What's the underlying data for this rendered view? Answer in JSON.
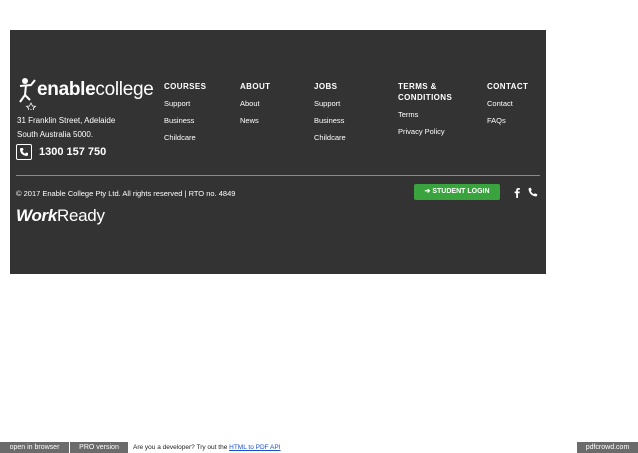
{
  "footer": {
    "logo": {
      "bold": "enable",
      "thin": "college"
    },
    "address_line1": "31 Franklin Street, Adelaide",
    "address_line2": "South Australia 5000.",
    "phone": "1300 157 750",
    "columns": [
      {
        "title": "COURSES",
        "links": [
          "Support",
          "Business",
          "Childcare"
        ]
      },
      {
        "title": "ABOUT",
        "links": [
          "About",
          "News"
        ]
      },
      {
        "title": "JOBS",
        "links": [
          "Support",
          "Business",
          "Childcare"
        ]
      },
      {
        "title": "TERMS & CONDITIONS",
        "links": [
          "Terms",
          "Privacy Policy"
        ]
      },
      {
        "title": "CONTACT",
        "links": [
          "Contact",
          "FAQs"
        ]
      }
    ],
    "copyright": "© 2017 Enable College Pty Ltd. All rights reserved | RTO no. 4849",
    "login_label": "STUDENT LOGIN",
    "workready": {
      "bold": "Work",
      "thin": "Ready"
    }
  },
  "pdf_bar": {
    "open_browser": "open in browser",
    "pro_version": "PRO version",
    "dev_prefix": "Are you a developer? Try out the ",
    "dev_link": "HTML to PDF API",
    "brand": "pdfcrowd.com"
  },
  "colors": {
    "footer_bg": "#333333",
    "login_green": "#39a43e",
    "bar_gray": "#6b6b6b",
    "link_blue": "#1a4fd1"
  },
  "icons": [
    "enable-college-logo-mark",
    "phone-icon",
    "sign-in-arrow-icon",
    "facebook-icon",
    "phone-call-icon"
  ]
}
